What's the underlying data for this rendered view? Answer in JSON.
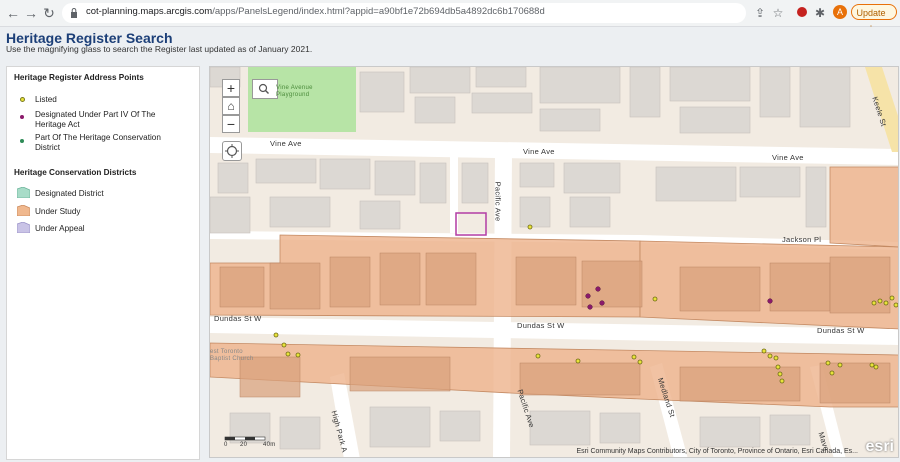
{
  "browser": {
    "url_host": "cot-planning.maps.arcgis.com",
    "url_path": "/apps/PanelsLegend/index.html?appid=a90bf1e72b694db5a4892dc6b170688d",
    "update_label": "Update",
    "profile_initial": "A",
    "icons": [
      "back-icon",
      "forward-icon",
      "reload-icon",
      "lock-icon",
      "share-icon",
      "star-icon",
      "extension-icon",
      "puzzle-icon"
    ]
  },
  "app": {
    "title": "Heritage Register Search",
    "subtitle": "Use the magnifying glass to search the Register last updated as of January 2021."
  },
  "legend": {
    "address_heading": "Heritage Register Address Points",
    "points": [
      {
        "label": "Listed",
        "color": "#e8e33a"
      },
      {
        "label": "Designated Under Part IV Of The Heritage Act",
        "color": "#8b1a6b"
      },
      {
        "label": "Part Of The Heritage Conservation District",
        "color": "#2e8b57"
      }
    ],
    "districts_heading": "Heritage Conservation Districts",
    "districts": [
      {
        "label": "Designated District",
        "color": "#a8dcc8"
      },
      {
        "label": "Under Study",
        "color": "#f0b88e"
      },
      {
        "label": "Under Appeal",
        "color": "#c9c3e6"
      }
    ]
  },
  "map": {
    "streets": {
      "vine_ave_1": "Vine Ave",
      "vine_ave_2": "Vine Ave",
      "vine_ave_3": "Vine Ave",
      "keele": "Keele St",
      "pacific_ave_1": "Pacific Ave",
      "pacific_ave_2": "Pacific Ave",
      "jackson": "Jackson Pl",
      "dundas_1": "Dundas St W",
      "dundas_2": "Dundas St W",
      "dundas_3": "Dundas St W",
      "high_park": "High Park A",
      "medland": "Medland St",
      "mavety": "Mave",
      "vine_playground": "Vine Avenue Playground",
      "church": "est Toronto Baptist Church"
    },
    "scale_labels": [
      "0",
      "20",
      "40m"
    ],
    "attribution": "Esri Community Maps Contributors, City of Toronto, Province of Ontario, Esri Canada, Es...",
    "logo": "esri",
    "zoom_in_label": "+",
    "zoom_out_label": "−",
    "home_label": "⌂"
  }
}
